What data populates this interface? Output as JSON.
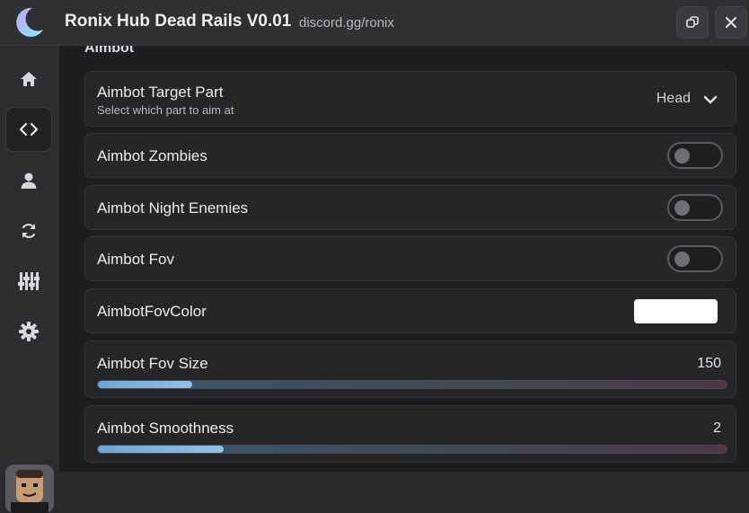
{
  "window": {
    "title": "Ronix Hub Dead Rails V0.01",
    "subtitle": "discord.gg/ronix"
  },
  "sidebar": {
    "items": [
      {
        "icon": "home-icon",
        "active": false
      },
      {
        "icon": "code-icon",
        "active": true
      },
      {
        "icon": "user-icon",
        "active": false
      },
      {
        "icon": "refresh-icon",
        "active": false
      },
      {
        "icon": "sliders-icon",
        "active": false
      },
      {
        "icon": "gear-icon",
        "active": false
      }
    ]
  },
  "main": {
    "section_title": "Aimbot",
    "target_part": {
      "label": "Aimbot Target Part",
      "description": "Select which part to aim at",
      "value": "Head"
    },
    "toggles": [
      {
        "label": "Aimbot Zombies",
        "on": false
      },
      {
        "label": "Aimbot Night Enemies",
        "on": false
      },
      {
        "label": "Aimbot Fov",
        "on": false
      }
    ],
    "fov_color": {
      "label": "AimbotFovColor",
      "color": "#ffffff"
    },
    "sliders": [
      {
        "label": "Aimbot Fov Size",
        "value": "150",
        "fill_fraction": 0.15
      },
      {
        "label": "Aimbot Smoothness",
        "value": "2",
        "fill_fraction": 0.2
      }
    ]
  },
  "colors": {
    "slider_fill": "#7cb4de",
    "toggle_off": "#6e6e73"
  }
}
